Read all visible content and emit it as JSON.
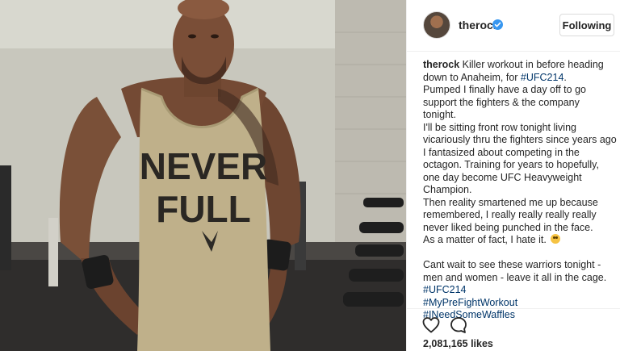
{
  "header": {
    "username": "therock",
    "verified_icon": "verified-badge-icon",
    "follow_label": "Following"
  },
  "caption": {
    "username": "therock",
    "line1_text": " Killer workout in before heading",
    "line2_text": "down to Anaheim, for ",
    "line2_tag": "#UFC214",
    "line2_end": ".",
    "line3": "Pumped I finally have a day off to go",
    "line4": "support the fighters & the company",
    "line5": "tonight.",
    "line6": "I'll be sitting front row tonight living",
    "line7": "vicariously thru the fighters since years ago",
    "line8": "I fantasized about competing in the",
    "line9": "octagon. Training for years to hopefully,",
    "line10": "one day become UFC Heavyweight",
    "line11": "Champion.",
    "line12": "Then reality smartened me up because",
    "line13": "remembered, I really really really really",
    "line14": "never liked being punched in the face.",
    "line15": "As a matter of fact, I hate it.",
    "line15_emoji": "grimacing-face-emoji",
    "line16": "Cant wait to see these warriors tonight -",
    "line17": "men and women - leave it all in the cage.",
    "tags": [
      "#UFC214",
      "#MyPreFightWorkout",
      "#INeedSomeWaffles"
    ]
  },
  "photo": {
    "shirt_text_1": "NEVER",
    "shirt_text_2": "FULL"
  },
  "actions": {
    "like_icon": "heart-icon",
    "comment_icon": "comment-icon",
    "likes_text": "2,081,165 likes"
  },
  "colors": {
    "hashtag": "#003569",
    "text": "#262626",
    "verified": "#3897f0",
    "border": "#efefef"
  }
}
